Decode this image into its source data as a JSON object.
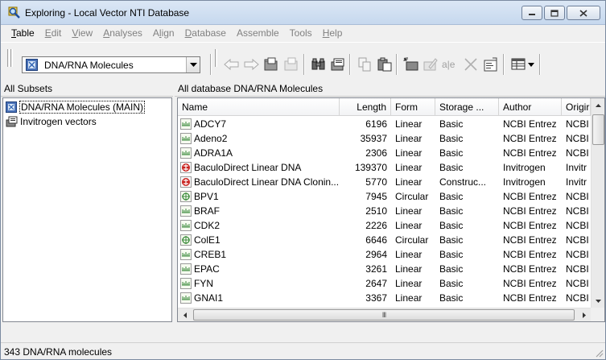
{
  "window": {
    "title": "Exploring - Local Vector NTI Database"
  },
  "menu": [
    {
      "label": "Table",
      "ul": "T",
      "rest": "able",
      "enabled": true
    },
    {
      "label": "Edit",
      "ul": "E",
      "rest": "dit",
      "enabled": false
    },
    {
      "label": "View",
      "ul": "V",
      "rest": "iew",
      "enabled": false
    },
    {
      "label": "Analyses",
      "ul": "A",
      "rest": "nalyses",
      "enabled": false
    },
    {
      "label": "Align",
      "ul": "l",
      "rest": "ign",
      "enabled": false,
      "pre": "A"
    },
    {
      "label": "Database",
      "ul": "D",
      "rest": "atabase",
      "enabled": false
    },
    {
      "label": "Assemble",
      "ul": "",
      "rest": "Assemble",
      "enabled": false
    },
    {
      "label": "Tools",
      "ul": "",
      "rest": "Tools",
      "enabled": false
    },
    {
      "label": "Help",
      "ul": "H",
      "rest": "elp",
      "enabled": false
    }
  ],
  "toolbar": {
    "combo_value": "DNA/RNA Molecules"
  },
  "left_panel": {
    "header": "All Subsets",
    "items": [
      {
        "label": "DNA/RNA Molecules (MAIN)",
        "icon": "dna-database-icon",
        "selected": true
      },
      {
        "label": "Invitrogen vectors",
        "icon": "subset-folder-icon",
        "selected": false
      }
    ]
  },
  "right_panel": {
    "header": "All database DNA/RNA Molecules",
    "columns": [
      "Name",
      "Length",
      "Form",
      "Storage ...",
      "Author",
      "Origir"
    ],
    "rows": [
      {
        "name": "ADCY7",
        "length": "6196",
        "form": "Linear",
        "storage": "Basic",
        "author": "NCBI Entrez",
        "origin": "NCBI",
        "icon": "linear-dna-icon"
      },
      {
        "name": "Adeno2",
        "length": "35937",
        "form": "Linear",
        "storage": "Basic",
        "author": "NCBI Entrez",
        "origin": "NCBI",
        "icon": "linear-dna-icon"
      },
      {
        "name": "ADRA1A",
        "length": "2306",
        "form": "Linear",
        "storage": "Basic",
        "author": "NCBI Entrez",
        "origin": "NCBI",
        "icon": "linear-dna-icon"
      },
      {
        "name": "BaculoDirect Linear DNA",
        "length": "139370",
        "form": "Linear",
        "storage": "Basic",
        "author": "Invitrogen",
        "origin": "Invitr",
        "icon": "invitrogen-dna-icon"
      },
      {
        "name": "BaculoDirect Linear DNA Clonin...",
        "length": "5770",
        "form": "Linear",
        "storage": "Construc...",
        "author": "Invitrogen",
        "origin": "Invitr",
        "icon": "invitrogen-dna-icon"
      },
      {
        "name": "BPV1",
        "length": "7945",
        "form": "Circular",
        "storage": "Basic",
        "author": "NCBI Entrez",
        "origin": "NCBI",
        "icon": "circular-dna-icon"
      },
      {
        "name": "BRAF",
        "length": "2510",
        "form": "Linear",
        "storage": "Basic",
        "author": "NCBI Entrez",
        "origin": "NCBI",
        "icon": "linear-dna-icon"
      },
      {
        "name": "CDK2",
        "length": "2226",
        "form": "Linear",
        "storage": "Basic",
        "author": "NCBI Entrez",
        "origin": "NCBI",
        "icon": "linear-dna-icon"
      },
      {
        "name": "ColE1",
        "length": "6646",
        "form": "Circular",
        "storage": "Basic",
        "author": "NCBI Entrez",
        "origin": "NCBI",
        "icon": "circular-dna-icon"
      },
      {
        "name": "CREB1",
        "length": "2964",
        "form": "Linear",
        "storage": "Basic",
        "author": "NCBI Entrez",
        "origin": "NCBI",
        "icon": "linear-dna-icon"
      },
      {
        "name": "EPAC",
        "length": "3261",
        "form": "Linear",
        "storage": "Basic",
        "author": "NCBI Entrez",
        "origin": "NCBI",
        "icon": "linear-dna-icon"
      },
      {
        "name": "FYN",
        "length": "2647",
        "form": "Linear",
        "storage": "Basic",
        "author": "NCBI Entrez",
        "origin": "NCBI",
        "icon": "linear-dna-icon"
      },
      {
        "name": "GNAI1",
        "length": "3367",
        "form": "Linear",
        "storage": "Basic",
        "author": "NCBI Entrez",
        "origin": "NCBI",
        "icon": "linear-dna-icon"
      }
    ],
    "hscroll_grip": "III"
  },
  "status": {
    "text": "343 DNA/RNA molecules"
  },
  "colors": {
    "accent": "#1e5eb8",
    "invitrogen_red": "#c8201c",
    "dna_green": "#3a8a3a"
  }
}
